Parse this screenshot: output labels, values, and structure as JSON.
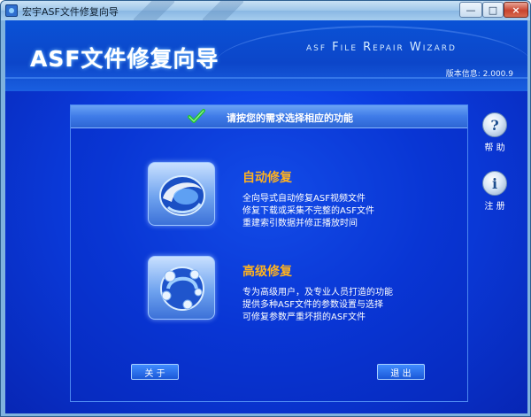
{
  "window": {
    "title": "宏宇ASF文件修复向导",
    "minimize_label": "—",
    "maximize_label": "□",
    "close_label": "×"
  },
  "header": {
    "main_title": "ASF文件修复向导",
    "english_title": "asf File Repair Wizard",
    "version": "版本信息: 2.000.9"
  },
  "panel": {
    "instruction": "请按您的需求选择相应的功能",
    "options": [
      {
        "title": "自动修复",
        "icon": "auto-repair-icon",
        "lines": [
          "全向导式自动修复ASF视频文件",
          "修复下载或采集不完整的ASF文件",
          "重建索引数据并修正播放时间"
        ]
      },
      {
        "title": "高级修复",
        "icon": "advanced-repair-icon",
        "lines": [
          "专为高级用户，及专业人员打造的功能",
          "提供多种ASF文件的参数设置与选择",
          "可修复参数严重坏损的ASF文件"
        ]
      }
    ],
    "about_label": "关 于",
    "exit_label": "退 出"
  },
  "side": {
    "help_label": "帮 助",
    "register_label": "注 册"
  },
  "colors": {
    "background": "#0b3de0",
    "option_title": "#ffb21f",
    "check": "#22c232"
  }
}
